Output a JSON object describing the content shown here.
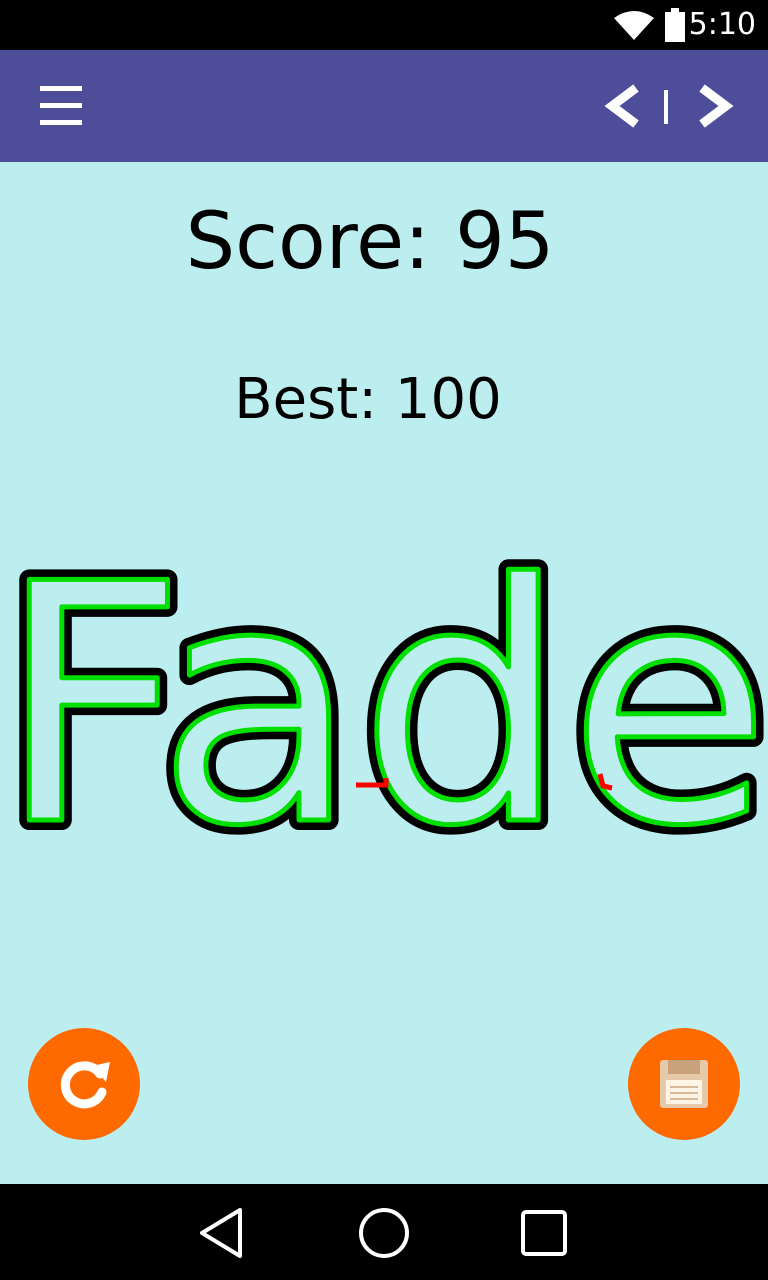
{
  "status_bar": {
    "time": "5:10",
    "icons": [
      "wifi-icon",
      "battery-icon"
    ]
  },
  "app_bar": {
    "color": "#4d4d99",
    "menu_icon": "hamburger-menu-icon",
    "prev_icon": "chevron-left-icon",
    "next_icon": "chevron-right-icon"
  },
  "main": {
    "background": "#bdeeef",
    "score_text": "Score: 95",
    "best_text": "Best: 100",
    "word": "Fade",
    "trace_color": "#00e000",
    "error_color": "#ff0000"
  },
  "actions": {
    "accent": "#ff6a00",
    "reset_icon": "refresh-icon",
    "save_icon": "floppy-disk-icon"
  },
  "system_nav": {
    "icons": [
      "back-triangle-icon",
      "home-circle-icon",
      "recents-square-icon"
    ]
  }
}
